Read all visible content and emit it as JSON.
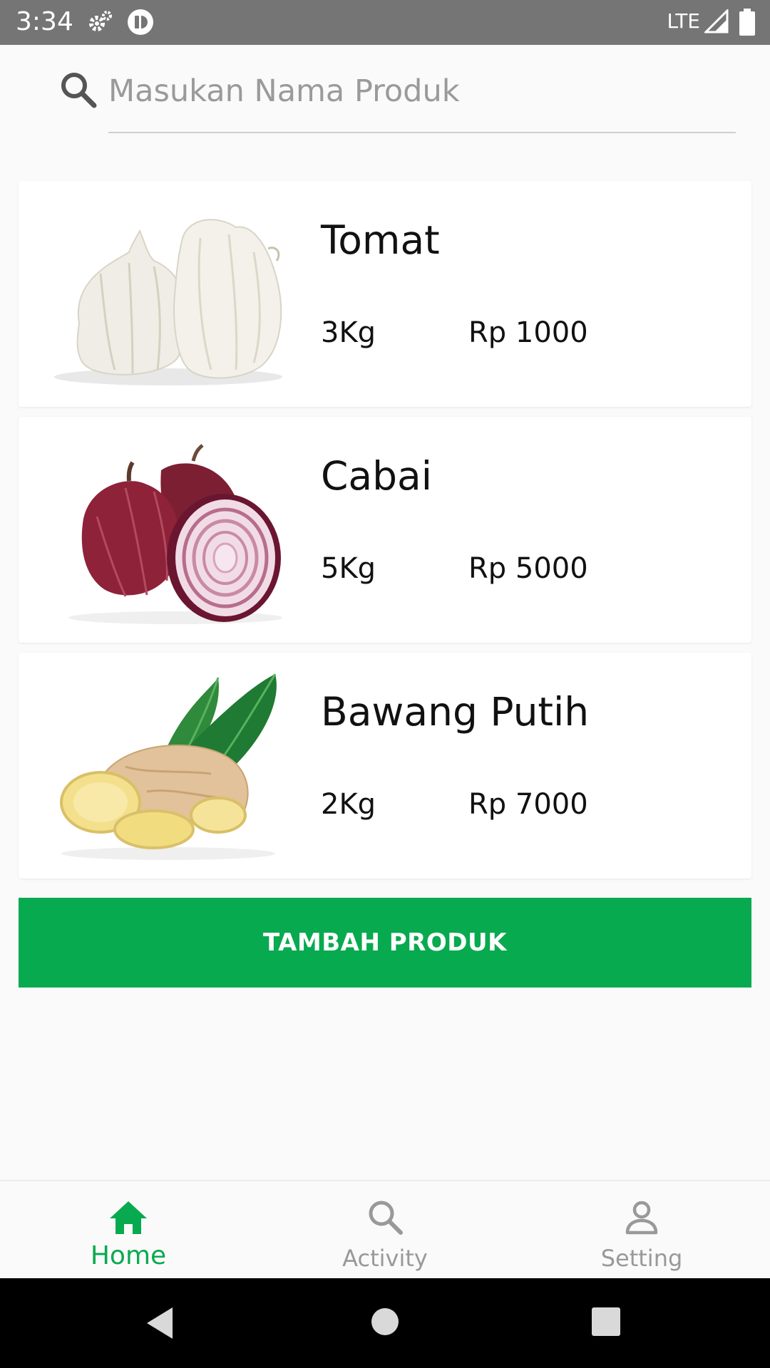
{
  "status_bar": {
    "time": "3:34",
    "network": "LTE",
    "background": "#757575",
    "icons": [
      "settings-gear-icon",
      "app-notification-icon",
      "signal-icon",
      "battery-icon"
    ]
  },
  "search": {
    "placeholder": "Masukan Nama Produk",
    "value": "",
    "icon": "search-icon"
  },
  "products": [
    {
      "name": "Tomat",
      "weight": "3Kg",
      "price": "Rp 1000",
      "image": "garlic-image"
    },
    {
      "name": "Cabai",
      "weight": "5Kg",
      "price": "Rp 5000",
      "image": "red-onion-image"
    },
    {
      "name": "Bawang Putih",
      "weight": "2Kg",
      "price": "Rp 7000",
      "image": "ginger-image"
    }
  ],
  "add_button": {
    "label": "TAMBAH PRODUK"
  },
  "bottom_nav": {
    "items": [
      {
        "label": "Home",
        "icon": "home-icon",
        "active": true
      },
      {
        "label": "Activity",
        "icon": "search-icon",
        "active": false
      },
      {
        "label": "Setting",
        "icon": "person-icon",
        "active": false
      }
    ]
  },
  "system_nav": {
    "icons": [
      "back-icon",
      "home-circle-icon",
      "recents-icon"
    ]
  },
  "colors": {
    "accent": "#08aa4f",
    "inactive": "#999999",
    "background": "#fafafa",
    "card": "#ffffff"
  }
}
